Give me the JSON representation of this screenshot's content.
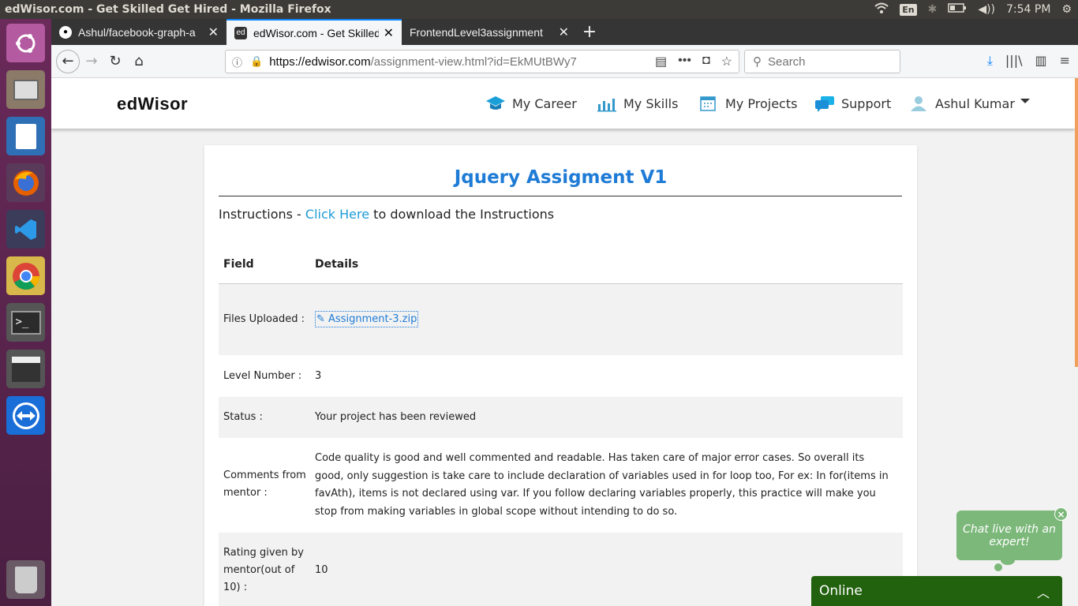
{
  "os": {
    "window_title": "edWisor.com - Get Skilled Get Hired - Mozilla Firefox",
    "lang": "En",
    "clock": "7:54 PM"
  },
  "browser": {
    "tabs": [
      {
        "label": "Ashul/facebook-graph-a",
        "active": false
      },
      {
        "label": "edWisor.com - Get Skilled",
        "active": true
      },
      {
        "label": "FrontendLevel3assignment",
        "active": false
      }
    ],
    "url_host": "https://edwisor.com",
    "url_path": "/assignment-view.html?id=EkMUtBWy7",
    "search_placeholder": "Search"
  },
  "site": {
    "logo": "edWisor",
    "nav": [
      "My Career",
      "My Skills",
      "My Projects",
      "Support",
      "Ashul Kumar"
    ]
  },
  "assignment": {
    "title": "Jquery Assigment V1",
    "instructions_prefix": "Instructions - ",
    "instructions_link": "Click Here",
    "instructions_suffix": " to download the Instructions",
    "table_headers": {
      "field": "Field",
      "details": "Details"
    },
    "rows": {
      "files_label": "Files Uploaded :",
      "files_value": "✎ Assignment-3.zip",
      "level_label": "Level Number :",
      "level_value": "3",
      "status_label": "Status :",
      "status_value": "Your project has been reviewed",
      "comments_label": "Comments from mentor :",
      "comments_value": "Code quality is good and well commented and readable. Has taken care of major error cases. So overall its good, only suggestion is take care to include declaration of variables used in for loop too, For ex: In for(items in favAth), items is not declared using var. If you follow declaring variables properly, this practice will make you stop from making variables in global scope without intending to do so.",
      "rating_label": "Rating given by mentor(out of 10) :",
      "rating_value": "10"
    }
  },
  "chat": {
    "bubble": "Chat live with an expert!",
    "close": "×",
    "online": "Online"
  }
}
